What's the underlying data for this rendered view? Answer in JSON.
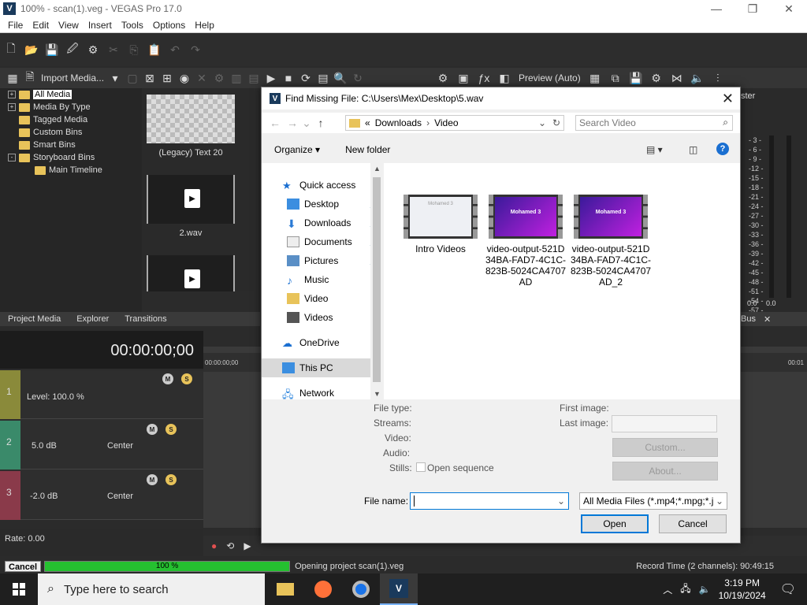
{
  "app": {
    "title": "100% - scan(1).veg - VEGAS Pro 17.0",
    "icon_letter": "V",
    "menu": [
      "File",
      "Edit",
      "View",
      "Insert",
      "Tools",
      "Options",
      "Help"
    ]
  },
  "toolbar2": {
    "import_label": "Import Media...",
    "preview_label": "Preview (Auto)"
  },
  "media_tree": [
    {
      "label": "All Media",
      "selected": true,
      "expander": "+"
    },
    {
      "label": "Media By Type",
      "expander": "+"
    },
    {
      "label": "Tagged Media"
    },
    {
      "label": "Custom Bins"
    },
    {
      "label": "Smart Bins"
    },
    {
      "label": "Storyboard Bins",
      "expander": "-"
    },
    {
      "label": "Main Timeline",
      "indent": true
    }
  ],
  "media_thumbs": {
    "item1": "(Legacy) Text 20",
    "item2": "2.wav"
  },
  "panel_tabs": [
    "Project Media",
    "Explorer",
    "Transitions"
  ],
  "meter": {
    "label": "ster",
    "ticks": [
      "- 3 -",
      "- 6 -",
      "- 9 -",
      "-12 -",
      "-15 -",
      "-18 -",
      "-21 -",
      "-24 -",
      "-27 -",
      "-30 -",
      "-33 -",
      "-36 -",
      "-39 -",
      "-42 -",
      "-45 -",
      "-48 -",
      "-51 -",
      "-54 -",
      "-57 -"
    ],
    "bottom_left": "0.0",
    "bottom_right": "0.0",
    "bus_tab": "Bus"
  },
  "timecode": "00:00:00;00",
  "ruler": {
    "start": "00:00:00;00",
    "end": "00:01"
  },
  "tracks": [
    {
      "num": "1",
      "level": "Level: 100.0 %"
    },
    {
      "num": "2",
      "vol": "5.0 dB",
      "pan": "Center"
    },
    {
      "num": "3",
      "vol": "-2.0 dB",
      "pan": "Center"
    }
  ],
  "rate": "Rate: 0.00",
  "status": {
    "cancel": "Cancel",
    "progress_text": "100 %",
    "progress_fraction": 1.0,
    "message": "Opening project scan(1).veg",
    "record_time": "Record Time (2 channels): 90:49:15"
  },
  "taskbar": {
    "search_placeholder": "Type here to search",
    "time": "3:19 PM",
    "date": "10/19/2024"
  },
  "dialog": {
    "title": "Find Missing File: C:\\Users\\Mex\\Desktop\\5.wav",
    "breadcrumb": [
      "Downloads",
      "Video"
    ],
    "breadcrumb_prefix": "«",
    "search_placeholder": "Search Video",
    "organize": "Organize ▾",
    "new_folder": "New folder",
    "nav": [
      {
        "label": "Quick access",
        "icon": "star-icon",
        "color": "#1a6fd1"
      },
      {
        "label": "Desktop",
        "icon": "desktop-icon",
        "color": "#3b8ee0",
        "pinned": true
      },
      {
        "label": "Downloads",
        "icon": "download-icon",
        "color": "#2b7bd6",
        "pinned": true
      },
      {
        "label": "Documents",
        "icon": "document-icon",
        "color": "#999999",
        "pinned": true
      },
      {
        "label": "Pictures",
        "icon": "picture-icon",
        "color": "#5a8fc6",
        "pinned": true
      },
      {
        "label": "Music",
        "icon": "music-icon",
        "color": "#2b7bd6"
      },
      {
        "label": "Video",
        "icon": "folder-icon",
        "color": "#e8c35a"
      },
      {
        "label": "Videos",
        "icon": "video-icon",
        "color": "#555555"
      },
      {
        "label": "OneDrive",
        "icon": "cloud-icon",
        "color": "#1a6fd1"
      },
      {
        "label": "This PC",
        "icon": "computer-icon",
        "color": "#3b8ee0",
        "selected": true
      },
      {
        "label": "Network",
        "icon": "network-icon",
        "color": "#3b8ee0"
      }
    ],
    "files": [
      {
        "name": "Intro Videos",
        "thumb_text": "Mohamed 3",
        "thumb": "light"
      },
      {
        "name": "video-output-521D34BA-FAD7-4C1C-823B-5024CA4707AD",
        "thumb_text": "Mohamed 3",
        "thumb": "purple"
      },
      {
        "name": "video-output-521D34BA-FAD7-4C1C-823B-5024CA4707AD_2",
        "thumb_text": "Mohamed 3",
        "thumb": "purple"
      }
    ],
    "details": {
      "file_type": "File type:",
      "streams": "Streams:",
      "video": "Video:",
      "audio": "Audio:",
      "stills": "Stills:",
      "open_sequence": "Open sequence",
      "first_image": "First image:",
      "last_image": "Last image:",
      "custom": "Custom...",
      "about": "About..."
    },
    "file_name_label": "File name:",
    "file_name_value": "",
    "filter": "All Media Files (*.mp4;*.mpg;*.j",
    "open": "Open",
    "cancel": "Cancel"
  }
}
